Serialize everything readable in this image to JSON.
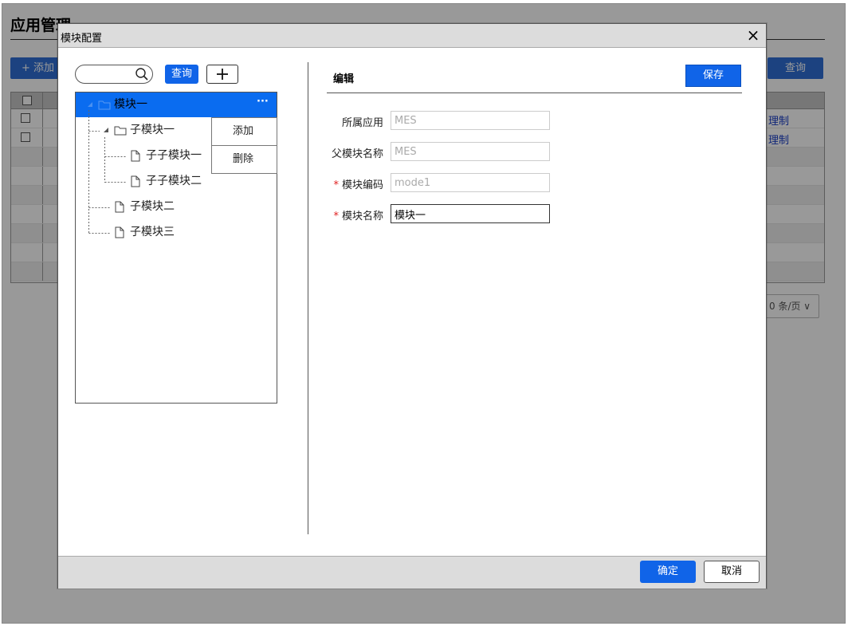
{
  "background": {
    "page_title": "应用管理",
    "add_button": "+ 添加",
    "query_button": "查询",
    "row_links": [
      "理制",
      "理制"
    ],
    "pager_label": "0 条/页 ∨"
  },
  "modal": {
    "title": "模块配置",
    "close_symbol": "×",
    "tree_toolbar": {
      "search_value": "",
      "query_label": "查询"
    },
    "tree": {
      "nodes": [
        {
          "label": "模块一",
          "type": "folder",
          "level": 0,
          "selected": true
        },
        {
          "label": "子模块一",
          "type": "folder",
          "level": 1
        },
        {
          "label": "子子模块一",
          "type": "file",
          "level": 2
        },
        {
          "label": "子子模块二",
          "type": "file",
          "level": 2
        },
        {
          "label": "子模块二",
          "type": "file",
          "level": 1
        },
        {
          "label": "子模块三",
          "type": "file",
          "level": 1
        }
      ],
      "more_symbol": "···"
    },
    "context_menu": {
      "add": "添加",
      "delete": "删除"
    },
    "edit": {
      "title": "编辑",
      "save_label": "保存",
      "fields": {
        "app": {
          "label": "所属应用",
          "value": "MES",
          "required": false
        },
        "parent": {
          "label": "父模块名称",
          "value": "MES",
          "required": false
        },
        "code": {
          "label": "模块编码",
          "value": "mode1",
          "required": true
        },
        "name": {
          "label": "模块名称",
          "value": "模块一",
          "required": true
        }
      },
      "required_mark": "*"
    },
    "footer": {
      "ok_label": "确定",
      "cancel_label": "取消"
    }
  },
  "colors": {
    "primary": "#1064e8",
    "selected_row": "#0a6cf0",
    "required": "#e02020",
    "overlay": "rgba(0,0,0,0.4)"
  }
}
